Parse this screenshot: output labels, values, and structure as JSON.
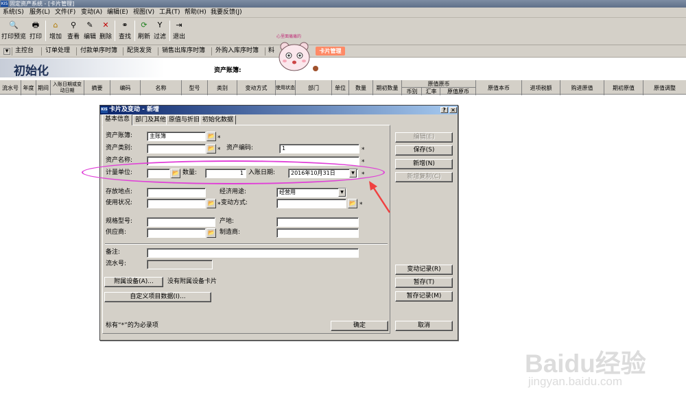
{
  "window": {
    "title": "固定资产系统 - [卡片管理]",
    "icon": "KIS"
  },
  "menu": [
    "系统(S)",
    "服务(L)",
    "文件(F)",
    "变动(A)",
    "编辑(E)",
    "视图(V)",
    "工具(T)",
    "帮助(H)",
    "我要反馈(J)"
  ],
  "toolbar": {
    "print_preview": "打印预览",
    "print": "打印",
    "add": "增加",
    "view": "查看",
    "edit": "编辑",
    "delete": "删除",
    "find": "查找",
    "refresh": "刷新",
    "filter": "过滤",
    "exit": "退出"
  },
  "navbar": [
    "主控台",
    "订单处理",
    "付款单序时簿",
    "配货发货",
    "销售出库序时簿",
    "外购入库序时簿",
    "料"
  ],
  "banner": {
    "title": "初始化",
    "account_label": "资产账簿:"
  },
  "mascot": {
    "caption": "心里面痛痛的",
    "badge": "卡片管理"
  },
  "grid_headers": [
    "流水号",
    "年度",
    "期间",
    "入账日期或变动日期",
    "摘要",
    "编码",
    "名称",
    "型号",
    "类别",
    "变动方式",
    "使用状态",
    "部门",
    "单位",
    "数量",
    "期初数量",
    "原值原币",
    "原值本币",
    "进项税额",
    "购进原值",
    "期初原值",
    "原值调整"
  ],
  "grid_subheaders": [
    "币别",
    "汇率",
    "原值原币"
  ],
  "dialog": {
    "title": "卡片及变动 - 新增",
    "icon": "KIS",
    "tabs": [
      "基本信息",
      "部门及其他",
      "原值与折旧",
      "初始化数据"
    ],
    "fields": {
      "book_label": "资产账簿:",
      "book_value": "主账簿",
      "category_label": "资产类别:",
      "code_label": "资产编码:",
      "code_value": "1",
      "name_label": "资产名称:",
      "unit_label": "计量单位:",
      "qty_label": "数量:",
      "qty_value": "1",
      "date_label": "入账日期:",
      "date_value": "2016年10月31日",
      "location_label": "存放地点:",
      "usage_label": "经济用途:",
      "usage_value": "经营用",
      "status_label": "使用状况:",
      "change_label": "变动方式:",
      "spec_label": "规格型号:",
      "origin_label": "产地:",
      "supplier_label": "供应商:",
      "maker_label": "制造商:",
      "remark_label": "备注:",
      "serial_label": "流水号:",
      "attach_button": "附属设备(A)...",
      "attach_note": "没有附属设备卡片",
      "custom_button": "自定义项目数据(I)...",
      "required_note": "标有“*”的为必录项"
    },
    "buttons": {
      "edit": "编辑(E)",
      "save": "保存(S)",
      "new": "新增(N)",
      "copy_new": "新增复制(C)",
      "change_record": "变动记录(R)",
      "temp_save": "暂存(T)",
      "temp_record": "暂存记录(M)",
      "ok": "确定",
      "cancel": "取消"
    }
  },
  "watermark": {
    "brand": "Baidu经验",
    "url": "jingyan.baidu.com"
  },
  "colors": {
    "annotation": "#e040d8",
    "arrow": "#f04040",
    "dialog_title": "#0a246a"
  }
}
